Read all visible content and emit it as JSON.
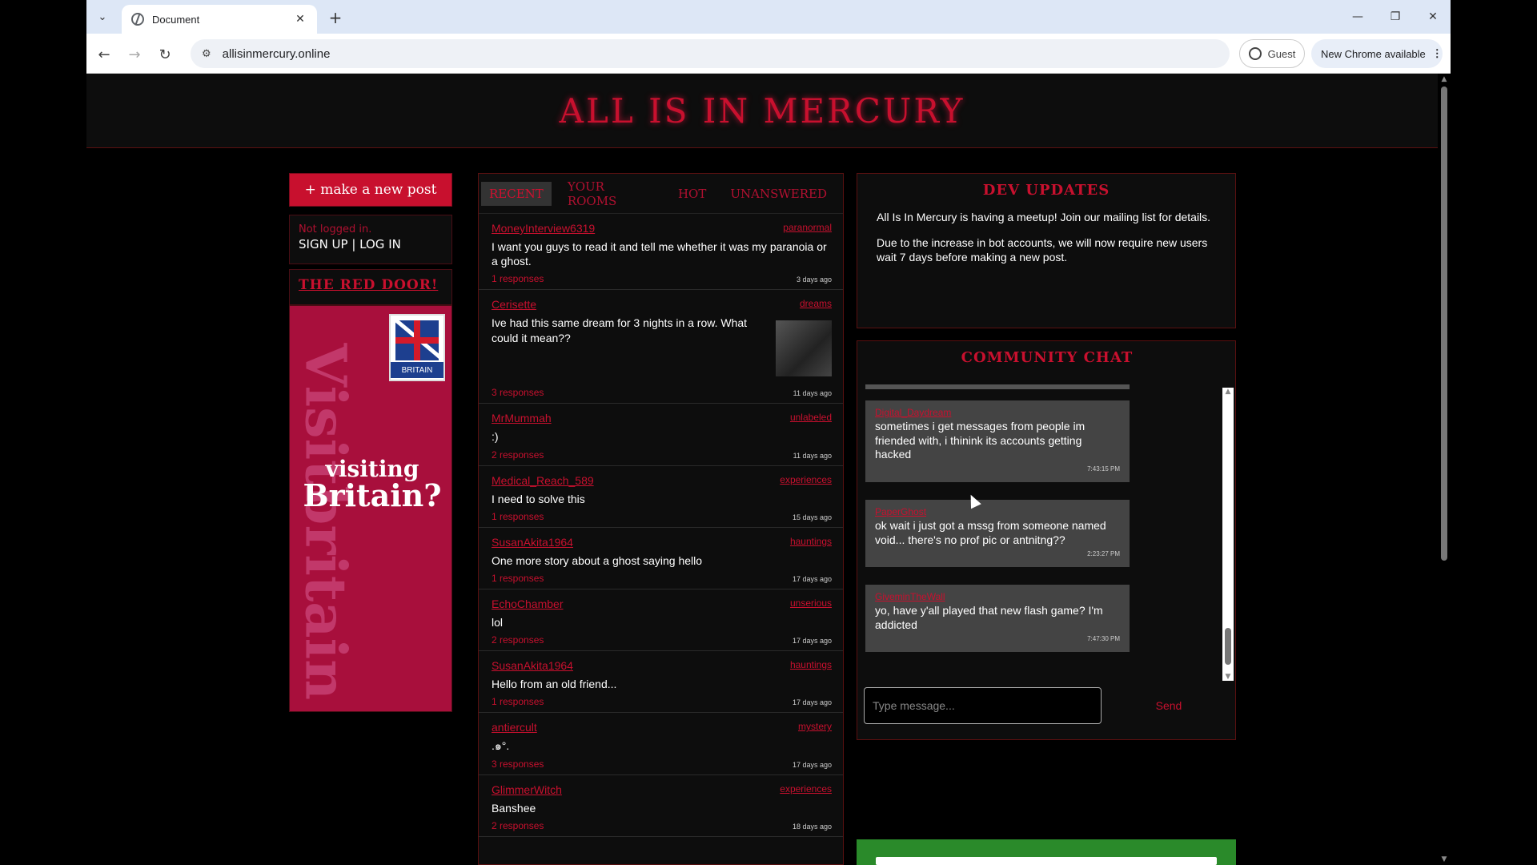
{
  "browser": {
    "tab_title": "Document",
    "url": "allisinmercury.online",
    "guest_label": "Guest",
    "update_label": "New Chrome available"
  },
  "site": {
    "title": "ALL IS IN MERCURY"
  },
  "sidebar": {
    "new_post_label": "+ make a new post",
    "login_status": "Not logged in.",
    "login_links": "SIGN UP | LOG IN",
    "red_door": "THE RED DOOR!",
    "ad": {
      "vertical_text": "Visitbritain",
      "brand": "BRITAIN",
      "headline_1": "visiting",
      "headline_2": "Britain?"
    }
  },
  "feed": {
    "tabs": [
      "RECENT",
      "YOUR ROOMS",
      "HOT",
      "UNANSWERED"
    ],
    "active_tab": "RECENT",
    "posts": [
      {
        "author": "MoneyInterview6319",
        "room": "paranormal",
        "body": "I want you guys to read it and tell me whether it was my paranoia or a ghost.",
        "responses": "1 responses",
        "age": "3 days ago",
        "has_thumb": false
      },
      {
        "author": "Cerisette",
        "room": "dreams",
        "body": "Ive had this same dream for 3 nights in a row. What could it mean??",
        "responses": "3 responses",
        "age": "11 days ago",
        "has_thumb": true
      },
      {
        "author": "MrMummah",
        "room": "unlabeled",
        "body": ":)",
        "responses": "2 responses",
        "age": "11 days ago",
        "has_thumb": false
      },
      {
        "author": "Medical_Reach_589",
        "room": "experiences",
        "body": "I need to solve this",
        "responses": "1 responses",
        "age": "15 days ago",
        "has_thumb": false
      },
      {
        "author": "SusanAkita1964",
        "room": "hauntings",
        "body": "One more story about a ghost saying hello",
        "responses": "1 responses",
        "age": "17 days ago",
        "has_thumb": false
      },
      {
        "author": "EchoChamber",
        "room": "unserious",
        "body": "lol",
        "responses": "2 responses",
        "age": "17 days ago",
        "has_thumb": false
      },
      {
        "author": "SusanAkita1964",
        "room": "hauntings",
        "body": "Hello from an old friend...",
        "responses": "1 responses",
        "age": "17 days ago",
        "has_thumb": false
      },
      {
        "author": "antiercult",
        "room": "mystery",
        "body": ".๑°.",
        "responses": "3 responses",
        "age": "17 days ago",
        "has_thumb": false
      },
      {
        "author": "GlimmerWitch",
        "room": "experiences",
        "body": "Banshee",
        "responses": "2 responses",
        "age": "18 days ago",
        "has_thumb": false
      }
    ]
  },
  "dev_updates": {
    "title": "DEV UPDATES",
    "paragraphs": [
      "All Is In Mercury is having a meetup! Join our mailing list for details.",
      "Due to the increase in bot accounts, we will now require new users wait 7 days before making a new post."
    ]
  },
  "chat": {
    "title": "COMMUNITY CHAT",
    "messages": [
      {
        "user": "Digital_Daydream",
        "text": "sometimes i get messages from people im friended with, i thinink its accounts getting hacked",
        "time": "7:43:15 PM"
      },
      {
        "user": "PaperGhost",
        "text": "ok wait i just got a mssg from someone named void... there's no prof pic or antnitng??",
        "time": "2:23:27 PM"
      },
      {
        "user": "GiveminTheWall",
        "text": "yo, have y'all played that new flash game? I'm addicted",
        "time": "7:47:30 PM"
      }
    ],
    "input_placeholder": "Type message...",
    "send_label": "Send"
  }
}
